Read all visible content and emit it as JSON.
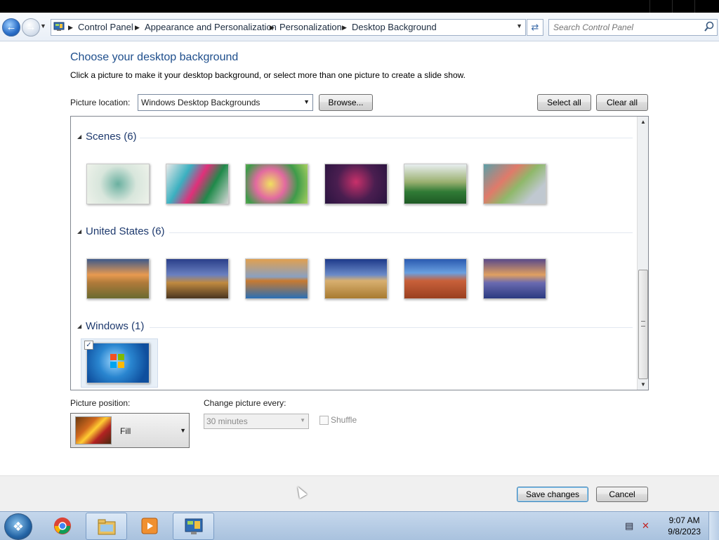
{
  "breadcrumbs": [
    "Control Panel",
    "Appearance and Personalization",
    "Personalization",
    "Desktop Background"
  ],
  "search": {
    "placeholder": "Search Control Panel"
  },
  "heading": "Choose your desktop background",
  "subheading": "Click a picture to make it your desktop background, or select more than one picture to create a slide show.",
  "location": {
    "label": "Picture location:",
    "value": "Windows Desktop Backgrounds",
    "browse_label": "Browse...",
    "select_all_label": "Select all",
    "clear_all_label": "Clear all"
  },
  "groups": [
    {
      "title": "Scenes (6)",
      "count": 6
    },
    {
      "title": "United States (6)",
      "count": 6
    },
    {
      "title": "Windows (1)",
      "count": 1
    }
  ],
  "windows_wallpaper_checked": true,
  "position": {
    "label": "Picture position:",
    "value": "Fill"
  },
  "interval": {
    "label": "Change picture every:",
    "value": "30 minutes"
  },
  "shuffle": {
    "label": "Shuffle",
    "checked": false
  },
  "footer": {
    "save_label": "Save changes",
    "cancel_label": "Cancel"
  },
  "taskbar": {
    "time": "9:07 AM",
    "date": "9/8/2023"
  }
}
